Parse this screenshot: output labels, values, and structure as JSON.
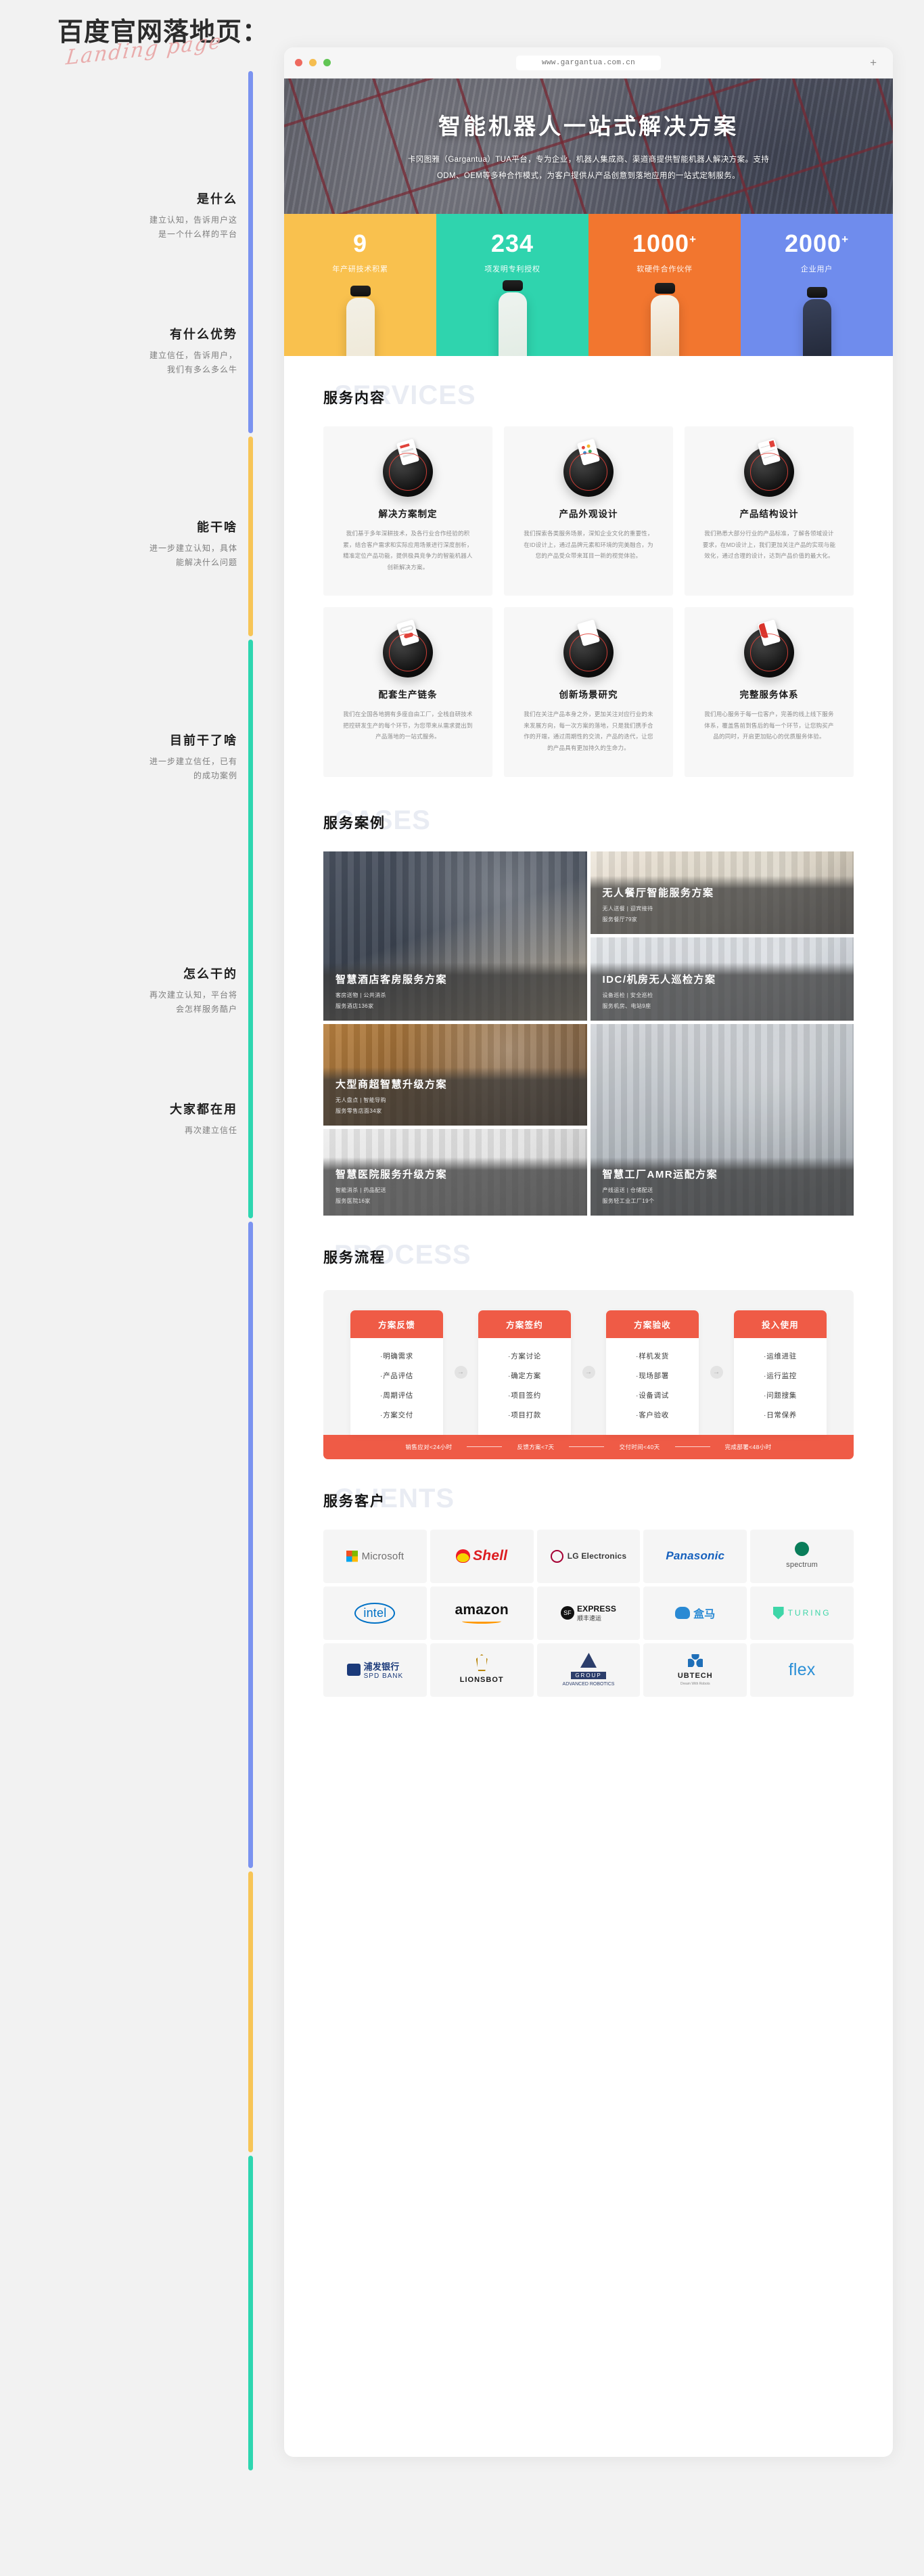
{
  "page": {
    "title": "百度官网落地页：",
    "script_subtitle": "Landing page"
  },
  "browser": {
    "url": "www.gargantua.com.cn",
    "new_tab_label": "+",
    "traffic_lights": [
      "close-red",
      "minimize-yellow",
      "maximize-green"
    ]
  },
  "annotations": [
    {
      "heading": "是什么",
      "body": "建立认知，告诉用户这\n是一个什么样的平台",
      "color": "#7b93f0"
    },
    {
      "heading": "有什么优势",
      "body": "建立信任，告诉用户，\n我们有多么多么牛",
      "color": "#f7c557"
    },
    {
      "heading": "能干啥",
      "body": "进一步建立认知，具体\n能解决什么问题",
      "color": "#2ed6b0"
    },
    {
      "heading": "目前干了啥",
      "body": "进一步建立信任，已有\n的成功案例",
      "color": "#7b93f0"
    },
    {
      "heading": "怎么干的",
      "body": "再次建立认知，平台将\n会怎样服务酷户",
      "color": "#f7c557"
    },
    {
      "heading": "大家都在用",
      "body": "再次建立信任",
      "color": "#2ed6b0"
    }
  ],
  "hero": {
    "title": "智能机器人一站式解决方案",
    "subtitle": "卡冈图雅（Gargantua）TUA平台，专为企业，机器人集成商、渠道商提供智能机器人解决方案。支持ODM、OEM等多种合作模式，为客户提供从产品创意到落地应用的一站式定制服务。"
  },
  "stats": [
    {
      "number": "9",
      "plus": "",
      "label": "年产研技术积累",
      "color": "#f9c14e"
    },
    {
      "number": "234",
      "plus": "",
      "label": "项发明专利授权",
      "color": "#2fd4ae"
    },
    {
      "number": "1000",
      "plus": "+",
      "label": "软硬件合作伙伴",
      "color": "#f2762f"
    },
    {
      "number": "2000",
      "plus": "+",
      "label": "企业用户",
      "color": "#6f8ced"
    }
  ],
  "services": {
    "heading_cn": "服务内容",
    "heading_ghost": "SERVICES",
    "cards": [
      {
        "title": "解决方案制定",
        "desc": "我们基于多年深耕技术，及各行业合作经验的积累，结合客户需求和实际应用场景进行深度剖析，精准定位产品功能，提供极具竞争力的智能机器人创新解决方案。"
      },
      {
        "title": "产品外观设计",
        "desc": "我们探索各类服务场景，深知企业文化的重要性，在ID设计上，通过品牌元素和环境的完美融合，为您的产品受众带来耳目一新的视觉体验。"
      },
      {
        "title": "产品结构设计",
        "desc": "我们熟悉大部分行业的产品标准，了解各领域设计要求，在MD设计上，我们更加关注产品的实现与能效化，通过合理的设计，达到产品价值的最大化。"
      },
      {
        "title": "配套生产链条",
        "desc": "我们在全国各地拥有多座自由工厂，全栈自研技术把控研发生产的每个环节，为您带来从需求提出到产品落地的一站式服务。"
      },
      {
        "title": "创新场景研究",
        "desc": "我们在关注产品本身之外，更加关注对应行业的未来发展方向，每一次方案的落地，只是我们携手合作的开端，通过周期性的交流，产品的迭代，让您的产品具有更加持久的生命力。"
      },
      {
        "title": "完整服务体系",
        "desc": "我们用心服务于每一位客户，完善的线上线下服务体系，覆盖售前到售后的每一个环节，让您购买产品的同时，开启更加贴心的优质服务体验。"
      }
    ]
  },
  "cases": {
    "heading_cn": "服务案例",
    "heading_ghost": "CASES",
    "items": [
      {
        "title": "智慧酒店客房服务方案",
        "meta1": "客房送物 | 公共消杀",
        "meta2": "服务酒店136家"
      },
      {
        "title": "无人餐厅智能服务方案",
        "meta1": "无人送餐 | 迎宾接待",
        "meta2": "服务餐厅79家"
      },
      {
        "title": "IDC/机房无人巡检方案",
        "meta1": "设备巡检 | 安全巡检",
        "meta2": "服务机房、电站9座"
      },
      {
        "title": "大型商超智慧升级方案",
        "meta1": "无人盘点 | 智能导购",
        "meta2": "服务零售店面34家"
      },
      {
        "title": "智慧医院服务升级方案",
        "meta1": "智能消杀 | 药品配送",
        "meta2": "服务医院16家"
      },
      {
        "title": "智慧工厂AMR运配方案",
        "meta1": "产线运送 | 仓储配送",
        "meta2": "服务轻工业工厂19个"
      }
    ]
  },
  "process": {
    "heading_cn": "服务流程",
    "heading_ghost": "PROCESS",
    "columns": [
      {
        "title": "方案反馈",
        "items": [
          "·明确需求",
          "·产品评估",
          "·周期评估",
          "·方案交付"
        ]
      },
      {
        "title": "方案签约",
        "items": [
          "·方案讨论",
          "·确定方案",
          "·项目签约",
          "·项目打款"
        ]
      },
      {
        "title": "方案验收",
        "items": [
          "·样机发货",
          "·现场部署",
          "·设备调试",
          "·客户验收"
        ]
      },
      {
        "title": "投入使用",
        "items": [
          "·运维进驻",
          "·运行监控",
          "·问题搜集",
          "·日常保养"
        ]
      }
    ],
    "timeline": [
      "销售应对<24小时",
      "反馈方案<7天",
      "交付时间<40天",
      "完成部署<48小时"
    ],
    "accent_color": "#ef5b46"
  },
  "clients": {
    "heading_cn": "服务客户",
    "heading_ghost": "CLIENTS",
    "logos": [
      {
        "name": "Microsoft",
        "text": "Microsoft",
        "color": "#706f6f",
        "kind": "microsoft"
      },
      {
        "name": "Shell",
        "text": "Shell",
        "color": "#dd1d21",
        "kind": "shell"
      },
      {
        "name": "LG Electronics",
        "text": "LG Electronics",
        "color": "#3a3a3a",
        "kind": "lg"
      },
      {
        "name": "Panasonic",
        "text": "Panasonic",
        "color": "#1560bd",
        "kind": "text"
      },
      {
        "name": "spectrum",
        "text": "spectrum",
        "color": "#0a7d5a",
        "kind": "spectrum"
      },
      {
        "name": "intel",
        "text": "intel",
        "color": "#0071c5",
        "kind": "intel"
      },
      {
        "name": "amazon",
        "text": "amazon",
        "color": "#111111",
        "kind": "amazon"
      },
      {
        "name": "SF EXPRESS",
        "text": "EXPRESS",
        "color": "#111111",
        "kind": "sf"
      },
      {
        "name": "盒马",
        "text": "盒马",
        "color": "#2a8ad4",
        "kind": "hema"
      },
      {
        "name": "TURING",
        "text": "TURING",
        "color": "#3ed6a8",
        "kind": "turing"
      },
      {
        "name": "SPD BANK",
        "text": "浦发银行",
        "color": "#1b3a7a",
        "kind": "spd"
      },
      {
        "name": "LIONSBOT",
        "text": "LIONSBOT",
        "color": "#1a1a1a",
        "kind": "lionsbot"
      },
      {
        "name": "ADVANCED ROBOTICS GROUP",
        "text": "GROUP",
        "color": "#2c3e6b",
        "kind": "arg"
      },
      {
        "name": "UBTECH",
        "text": "UBTECH",
        "color": "#1f6fb8",
        "kind": "ubtech"
      },
      {
        "name": "flex",
        "text": "flex",
        "color": "#2b8fd6",
        "kind": "flex"
      }
    ],
    "sublabels": {
      "sf": "顺丰速运",
      "spd": "SPD  BANK",
      "arg": "ADVANCED ROBOTICS",
      "ubtech": "Dream With Robots"
    }
  }
}
